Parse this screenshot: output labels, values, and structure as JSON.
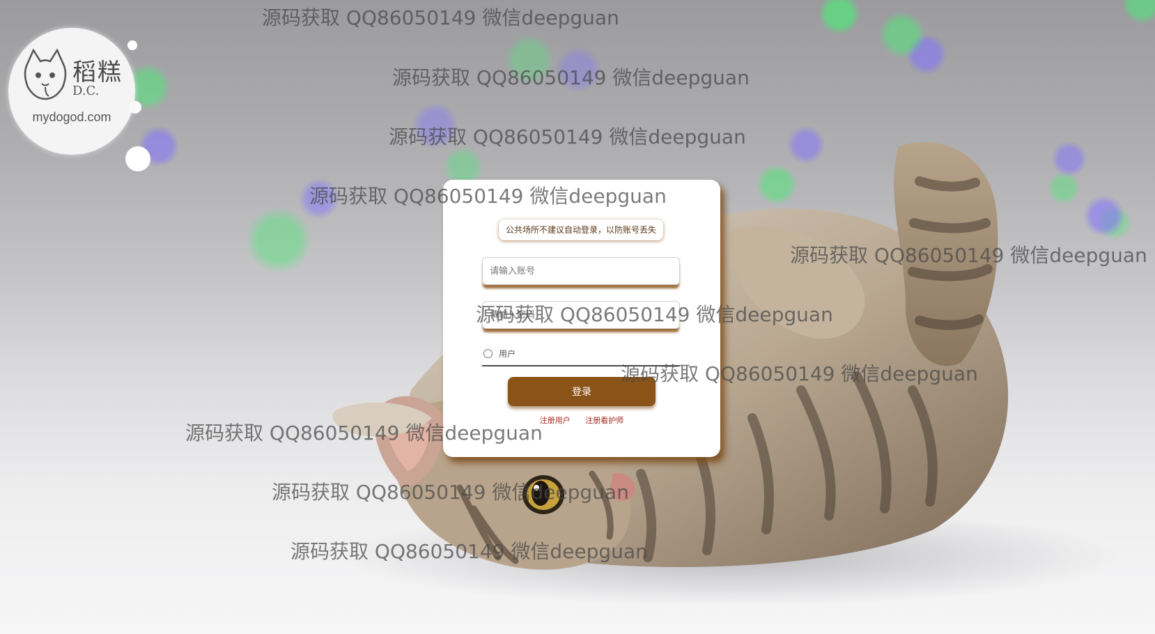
{
  "logo": {
    "brand": "稻糕",
    "dc": "D.C.",
    "site": "mydogod.com"
  },
  "login": {
    "notice": "公共场所不建议自动登录，以防账号丢失",
    "account_placeholder": "请输入账号",
    "password_placeholder": "请输入密码",
    "role_label": "用户",
    "login_button": "登录",
    "register_user": "注册用户",
    "register_caregiver": "注册看护师"
  },
  "watermark": {
    "text": "源码获取 QQ86050149 微信deepguan"
  },
  "colors": {
    "accent": "#8a5318",
    "link": "#a0281c"
  }
}
